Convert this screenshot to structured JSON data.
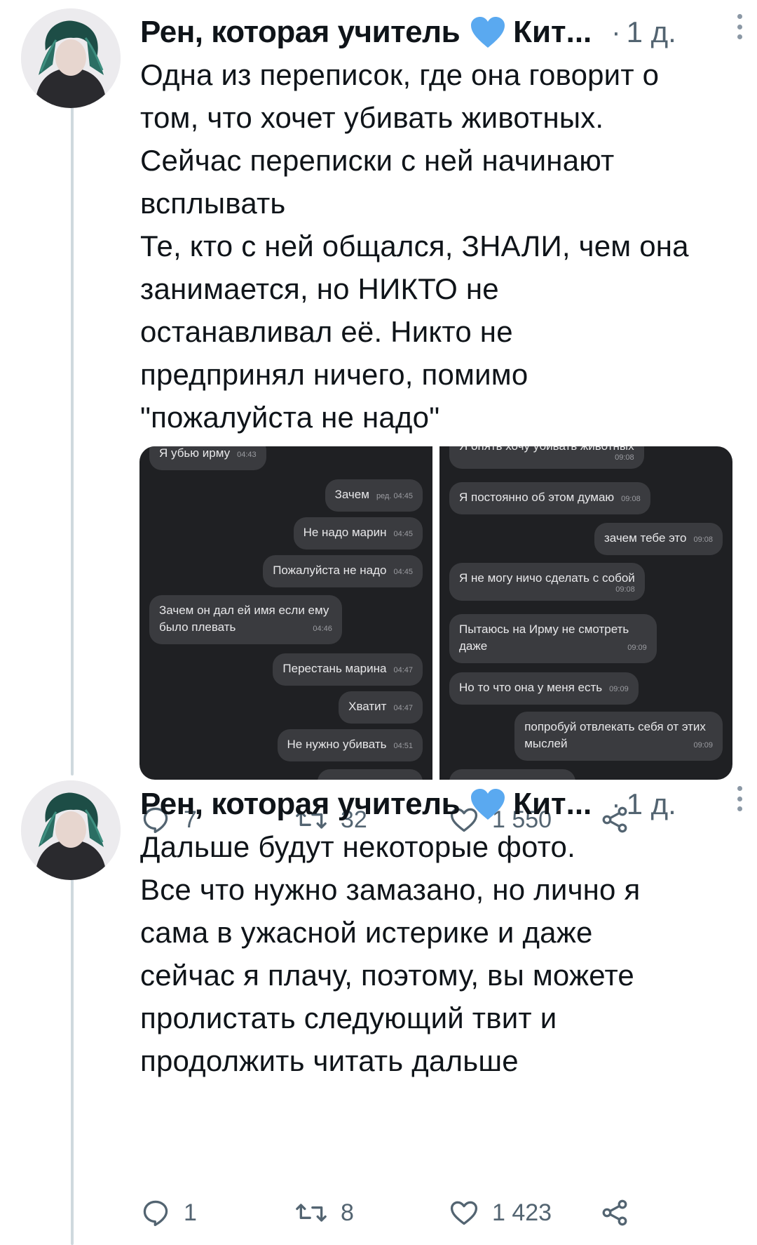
{
  "tweets": [
    {
      "author_name": "Рен, которая учитель",
      "handle": "Кит",
      "ellipsis": "...",
      "dot": "·",
      "time": "1 д.",
      "text_lines": [
        "Одна из переписок, где она говорит о",
        "том, что хочет убивать животных.",
        "Сейчас переписки с ней начинают",
        "всплывать",
        "Те, кто с ней общался, ЗНАЛИ, чем она",
        "занимается, но НИКТО не",
        "останавливал её. Никто не",
        "предпринял ничего, помимо",
        "\"пожалуйста не надо\""
      ],
      "media": {
        "left_chat": [
          {
            "text": "Я убью ирму",
            "time": "04:43",
            "side": "in"
          },
          {
            "text": "Зачем",
            "time": "ред. 04:45",
            "side": "out"
          },
          {
            "text": "Не надо марин",
            "time": "04:45",
            "side": "out"
          },
          {
            "text": "Пожалуйста не надо",
            "time": "04:45",
            "side": "out"
          },
          {
            "text": "Зачем он дал ей имя если ему",
            "text2": "было плевать",
            "time": "04:46",
            "side": "in"
          },
          {
            "text": "Перестань марина",
            "time": "04:47",
            "side": "out"
          },
          {
            "text": "Хватит",
            "time": "04:47",
            "side": "out"
          },
          {
            "text": "Не нужно убивать",
            "time": "04:51",
            "side": "out"
          }
        ],
        "right_chat": [
          {
            "text": "Я опять хочу убивать животных",
            "time": "09:08",
            "side": "in"
          },
          {
            "text": "Я постоянно об этом думаю",
            "time": "09:08",
            "side": "in"
          },
          {
            "text": "зачем тебе это",
            "time": "09:08",
            "side": "out"
          },
          {
            "text": "Я не могу ничо сделать с собой",
            "time": "09:08",
            "side": "in"
          },
          {
            "text": "Пытаюсь на Ирму не смотреть",
            "text2": "даже",
            "time": "09:09",
            "side": "in"
          },
          {
            "text": "Но то что она у меня есть",
            "time": "09:09",
            "side": "in"
          },
          {
            "text": "попробуй отвлекать себя от этих",
            "text2": "мыслей",
            "time": "09:09",
            "side": "out"
          }
        ]
      },
      "replies": "7",
      "retweets": "32",
      "likes": "1 550"
    },
    {
      "author_name": "Рен, которая учитель",
      "handle": "Кит",
      "ellipsis": "...",
      "dot": "·",
      "time": "1 д.",
      "text_lines": [
        "Дальше будут некоторые фото.",
        "Все что нужно замазано, но лично я",
        "сама в ужасной истерике и даже",
        "сейчас я плачу, поэтому, вы можете",
        "пролистать следующий твит и",
        "продолжить читать дальше"
      ],
      "replies": "1",
      "retweets": "8",
      "likes": "1 423"
    }
  ],
  "colors": {
    "text": "#0f1419",
    "secondary": "#536471",
    "heart_badge": "#5aa9f0",
    "thread_line": "#cfd9de",
    "chat_bg": "#1f2023",
    "bubble": "#3a3b3f"
  },
  "icons": [
    "reply-icon",
    "retweet-icon",
    "like-icon",
    "share-icon",
    "more-icon",
    "blue-heart-icon"
  ]
}
